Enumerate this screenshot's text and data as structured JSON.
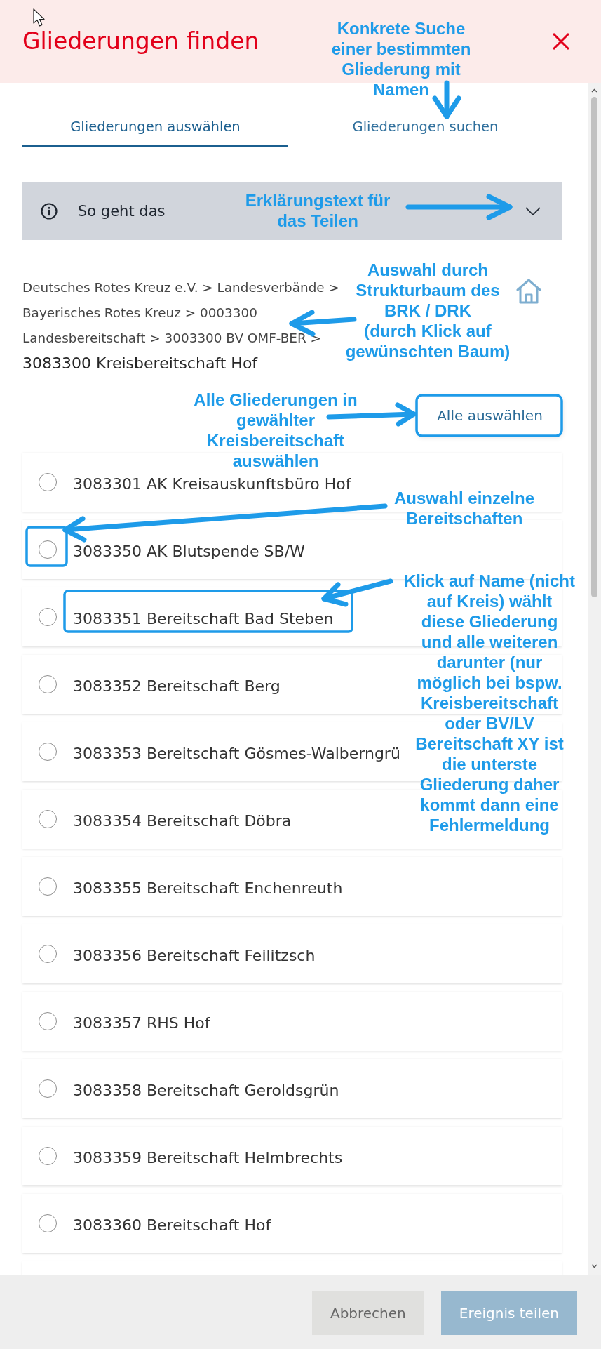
{
  "header": {
    "title": "Gliederungen finden"
  },
  "tabs": [
    {
      "label": "Gliederungen auswählen",
      "selected": true
    },
    {
      "label": "Gliederungen suchen",
      "selected": false
    }
  ],
  "info_panel": {
    "label": "So geht das",
    "expanded": false
  },
  "breadcrumb": {
    "path": "Deutsches Rotes Kreuz e.V. > Landesverbände > Bayerisches Rotes Kreuz > 0003300 Landesbereitschaft > 3003300 BV OMF-BER >",
    "current": "3083300 Kreisbereitschaft Hof"
  },
  "select_all_button": "Alle auswählen",
  "units": [
    {
      "name": "3083301 AK Kreisauskunftsbüro Hof",
      "selected": false
    },
    {
      "name": "3083350 AK Blutspende SB/W",
      "selected": false
    },
    {
      "name": "3083351 Bereitschaft Bad Steben",
      "selected": false
    },
    {
      "name": "3083352 Bereitschaft Berg",
      "selected": false
    },
    {
      "name": "3083353 Bereitschaft Gösmes-Walberngrü",
      "selected": false
    },
    {
      "name": "3083354 Bereitschaft Döbra",
      "selected": false
    },
    {
      "name": "3083355 Bereitschaft Enchenreuth",
      "selected": false
    },
    {
      "name": "3083356 Bereitschaft Feilitzsch",
      "selected": false
    },
    {
      "name": "3083357 RHS Hof",
      "selected": false
    },
    {
      "name": "3083358 Bereitschaft Geroldsgrün",
      "selected": false
    },
    {
      "name": "3083359 Bereitschaft Helmbrechts",
      "selected": false
    },
    {
      "name": "3083360 Bereitschaft Hof",
      "selected": false
    }
  ],
  "footer": {
    "buttons": [
      {
        "label": "Abbrechen",
        "kind": "secondary",
        "disabled": false
      },
      {
        "label": "Ereignis teilen",
        "kind": "primary",
        "disabled": true
      }
    ]
  },
  "annotations": [
    {
      "text": "Konkrete Suche\neiner bestimmten\nGliederung mit\nNamen"
    },
    {
      "text": "Erklärungstext für\ndas Teilen"
    },
    {
      "text": "Auswahl durch\nStrukturbaum des\nBRK / DRK\n(durch Klick auf\ngewünschten Baum)"
    },
    {
      "text": "Alle Gliederungen in\ngewählter\nKreisbereitschaft\nauswählen"
    },
    {
      "text": "Auswahl einzelne\nBereitschaften"
    },
    {
      "text": "Klick auf Name (nicht\nauf Kreis) wählt\ndiese Gliederung\nund alle weiteren\ndarunter (nur\nmöglich bei bspw.\nKreisbereitschaft\noder BV/LV\nBereitschaft XY ist\ndie unterste\nGliederung daher\nkommt dann eine\nFehlermeldung"
    }
  ]
}
